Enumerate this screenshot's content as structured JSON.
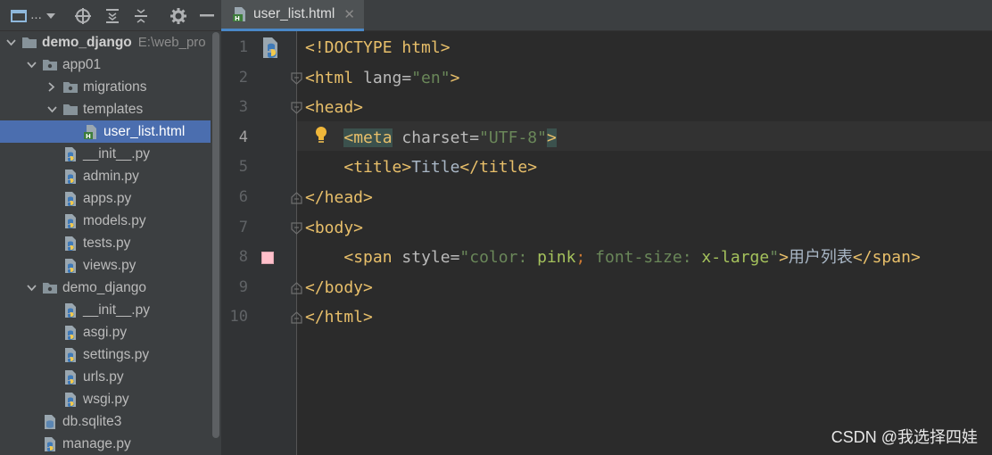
{
  "colors": {
    "sidebar_bg": "#3c3f41",
    "editor_bg": "#2b2b2b",
    "selection": "#4b6eaf",
    "tag": "#e8bf6a",
    "string": "#6a8759",
    "pink_swatch": "#ffc0cb"
  },
  "toolbar": {
    "view_label": "...",
    "icons": [
      "project-view-icon",
      "dropdown-icon",
      "locate-icon",
      "expand-all-icon",
      "collapse-all-icon",
      "settings-gear-icon",
      "hide-panel-icon"
    ]
  },
  "tree": [
    {
      "label": "demo_django",
      "path": "E:\\web_pro",
      "icon": "folder-icon",
      "arrow": "down",
      "indent": 0,
      "bold": true
    },
    {
      "label": "app01",
      "icon": "package-folder-icon",
      "arrow": "down",
      "indent": 1
    },
    {
      "label": "migrations",
      "icon": "package-folder-icon",
      "arrow": "right",
      "indent": 2
    },
    {
      "label": "templates",
      "icon": "folder-icon",
      "arrow": "down",
      "indent": 2
    },
    {
      "label": "user_list.html",
      "icon": "html-file-icon",
      "arrow": "none",
      "indent": 3,
      "selected": true
    },
    {
      "label": "__init__.py",
      "icon": "python-file-icon",
      "arrow": "none",
      "indent": 2
    },
    {
      "label": "admin.py",
      "icon": "python-file-icon",
      "arrow": "none",
      "indent": 2
    },
    {
      "label": "apps.py",
      "icon": "python-file-icon",
      "arrow": "none",
      "indent": 2
    },
    {
      "label": "models.py",
      "icon": "python-file-icon",
      "arrow": "none",
      "indent": 2
    },
    {
      "label": "tests.py",
      "icon": "python-file-icon",
      "arrow": "none",
      "indent": 2
    },
    {
      "label": "views.py",
      "icon": "python-file-icon",
      "arrow": "none",
      "indent": 2
    },
    {
      "label": "demo_django",
      "icon": "package-folder-icon",
      "arrow": "down",
      "indent": 1
    },
    {
      "label": "__init__.py",
      "icon": "python-file-icon",
      "arrow": "none",
      "indent": 2
    },
    {
      "label": "asgi.py",
      "icon": "python-file-icon",
      "arrow": "none",
      "indent": 2
    },
    {
      "label": "settings.py",
      "icon": "python-file-icon",
      "arrow": "none",
      "indent": 2
    },
    {
      "label": "urls.py",
      "icon": "python-file-icon",
      "arrow": "none",
      "indent": 2
    },
    {
      "label": "wsgi.py",
      "icon": "python-file-icon",
      "arrow": "none",
      "indent": 2
    },
    {
      "label": "db.sqlite3",
      "icon": "database-file-icon",
      "arrow": "none",
      "indent": 1
    },
    {
      "label": "manage.py",
      "icon": "python-file-icon",
      "arrow": "none",
      "indent": 1
    }
  ],
  "tab": {
    "label": "user_list.html",
    "close_glyph": "✕"
  },
  "editor": {
    "current_line": 4,
    "line_numbers": [
      "1",
      "2",
      "3",
      "4",
      "5",
      "6",
      "7",
      "8",
      "9",
      "10"
    ],
    "lines": [
      [
        [
          "t-doc",
          "<!DOCTYPE html>"
        ]
      ],
      [
        [
          "t-tag",
          "<html "
        ],
        [
          "t-attr",
          "lang="
        ],
        [
          "t-str",
          "\"en\""
        ],
        [
          "t-tag",
          ">"
        ]
      ],
      [
        [
          "t-tag",
          "<head>"
        ]
      ],
      [
        [
          "t-text",
          "    "
        ],
        [
          "t-tag hl-tag",
          "<meta"
        ],
        [
          "t-attr",
          " charset="
        ],
        [
          "t-str",
          "\"UTF-8\""
        ],
        [
          "t-tag hl-tag",
          ">"
        ]
      ],
      [
        [
          "t-text",
          "    "
        ],
        [
          "t-tag",
          "<title>"
        ],
        [
          "t-text",
          "Title"
        ],
        [
          "t-tag",
          "</title>"
        ]
      ],
      [
        [
          "t-tag",
          "</head>"
        ]
      ],
      [
        [
          "t-tag",
          "<body>"
        ]
      ],
      [
        [
          "t-text",
          "    "
        ],
        [
          "t-tag",
          "<span "
        ],
        [
          "t-attr",
          "style="
        ],
        [
          "t-str",
          "\"color: "
        ],
        [
          "t-css",
          "pink"
        ],
        [
          "t-punct",
          ";"
        ],
        [
          "t-str",
          " font-size: "
        ],
        [
          "t-css",
          "x-large"
        ],
        [
          "t-str",
          "\""
        ],
        [
          "t-tag",
          ">"
        ],
        [
          "t-text",
          "用户列表"
        ],
        [
          "t-tag",
          "</span>"
        ]
      ],
      [
        [
          "t-tag",
          "</body>"
        ]
      ],
      [
        [
          "t-tag",
          "</html>"
        ]
      ]
    ],
    "gutter_icons": {
      "line1": "python-html-badge-icon",
      "line4": "lightbulb-icon",
      "line8": "color-swatch-icon"
    }
  },
  "watermark": "CSDN @我选择四娃"
}
